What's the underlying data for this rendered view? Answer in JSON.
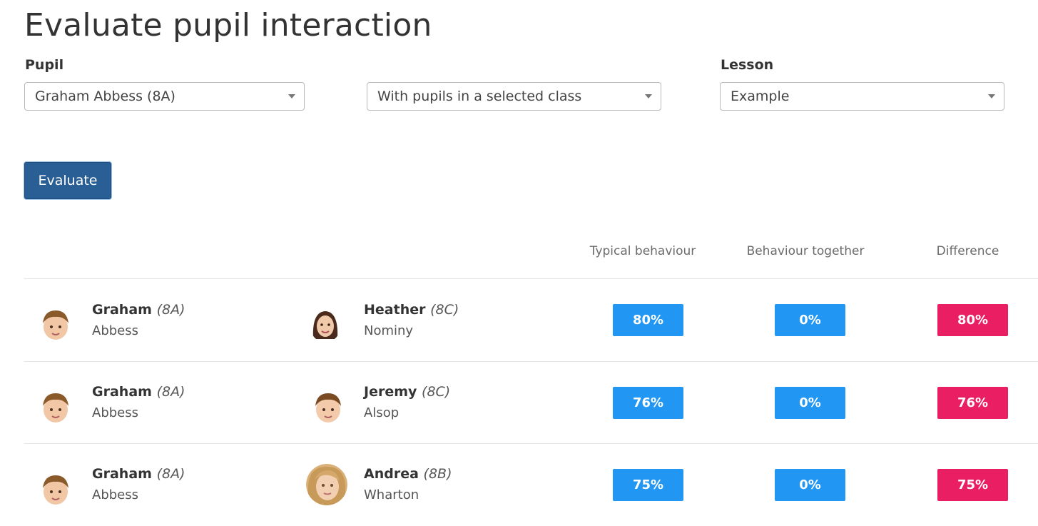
{
  "page": {
    "title": "Evaluate pupil interaction"
  },
  "filters": {
    "pupil_label": "Pupil",
    "pupil_value": "Graham Abbess (8A)",
    "mode_value": "With pupils in a selected class",
    "lesson_label": "Lesson",
    "lesson_value": "Example"
  },
  "actions": {
    "evaluate_label": "Evaluate"
  },
  "table": {
    "headers": [
      "Typical behaviour",
      "Behaviour together",
      "Difference"
    ],
    "rows": [
      {
        "pupil": {
          "first": "Graham",
          "class": "(8A)",
          "last": "Abbess"
        },
        "other": {
          "first": "Heather",
          "class": "(8C)",
          "last": "Nominy"
        },
        "typical": "80%",
        "together": "0%",
        "difference": "80%"
      },
      {
        "pupil": {
          "first": "Graham",
          "class": "(8A)",
          "last": "Abbess"
        },
        "other": {
          "first": "Jeremy",
          "class": "(8C)",
          "last": "Alsop"
        },
        "typical": "76%",
        "together": "0%",
        "difference": "76%"
      },
      {
        "pupil": {
          "first": "Graham",
          "class": "(8A)",
          "last": "Abbess"
        },
        "other": {
          "first": "Andrea",
          "class": "(8B)",
          "last": "Wharton"
        },
        "typical": "75%",
        "together": "0%",
        "difference": "75%"
      }
    ]
  },
  "colors": {
    "primary": "#2a5f96",
    "blue_badge": "#2196f3",
    "pink_badge": "#e91e63"
  }
}
